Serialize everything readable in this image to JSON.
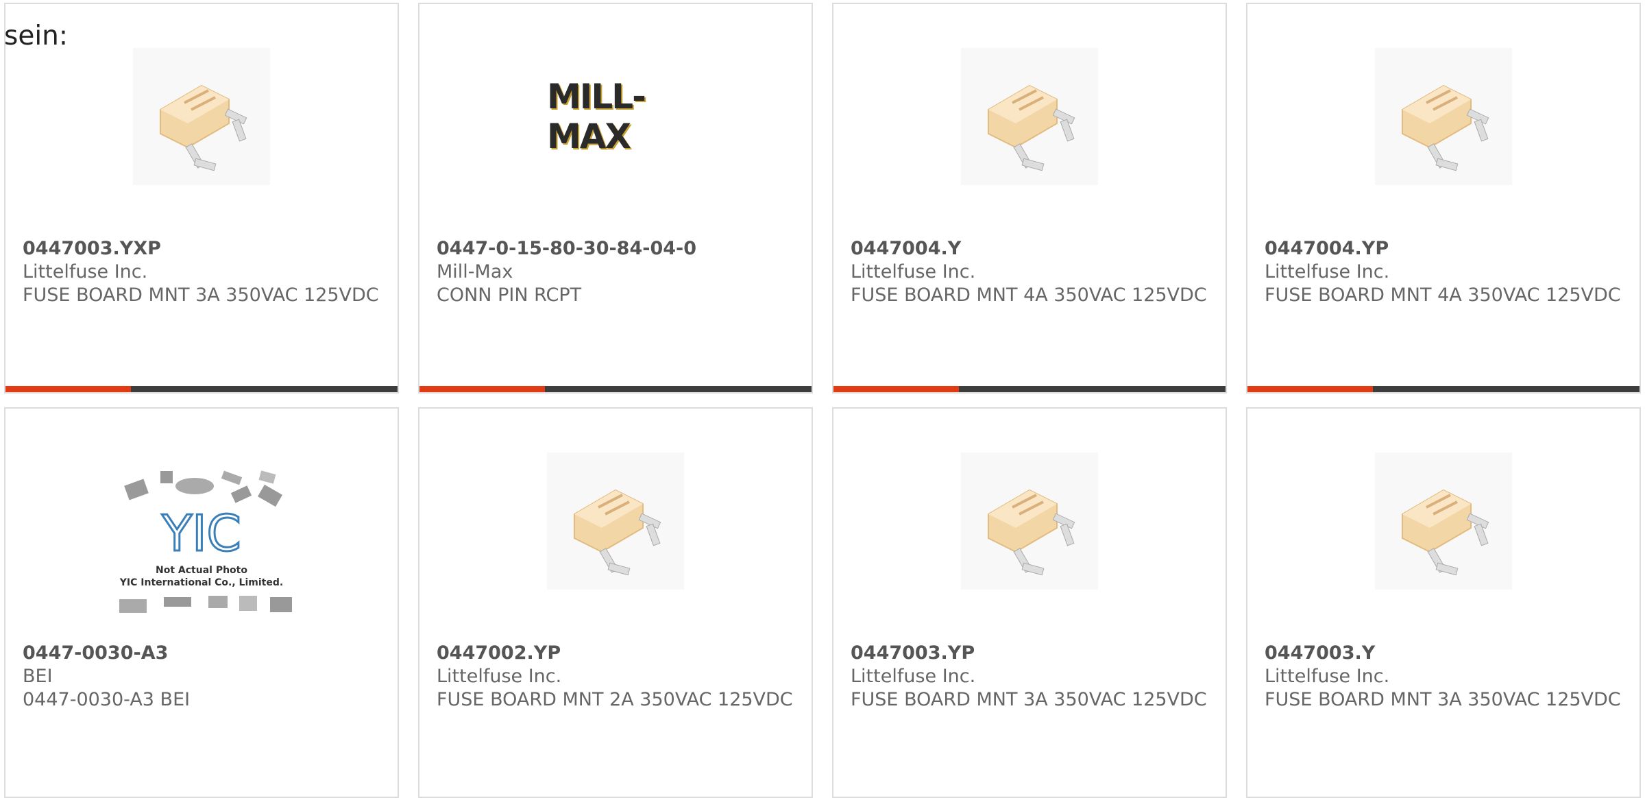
{
  "page": {
    "label": "sein:"
  },
  "products": [
    {
      "part": "0447003.YXP",
      "manufacturer": "Littelfuse Inc.",
      "description": "FUSE BOARD MNT 3A 350VAC 125VDC",
      "image": "fuse-icon",
      "has_bar": true
    },
    {
      "part": "0447-0-15-80-30-84-04-0",
      "manufacturer": "Mill-Max",
      "description": "CONN PIN RCPT",
      "image": "mill-max-logo",
      "logo_text": "MILL-MAX",
      "has_bar": true
    },
    {
      "part": "0447004.Y",
      "manufacturer": "Littelfuse Inc.",
      "description": "FUSE BOARD MNT 4A 350VAC 125VDC",
      "image": "fuse-icon",
      "has_bar": true
    },
    {
      "part": "0447004.YP",
      "manufacturer": "Littelfuse Inc.",
      "description": "FUSE BOARD MNT 4A 350VAC 125VDC",
      "image": "fuse-icon",
      "has_bar": true
    },
    {
      "part": "0447-0030-A3",
      "manufacturer": "BEI",
      "description": "0447-0030-A3 BEI",
      "image": "yic-placeholder",
      "placeholder_caption_1": "Not Actual Photo",
      "placeholder_caption_2": "YIC International Co., Limited.",
      "has_bar": false
    },
    {
      "part": "0447002.YP",
      "manufacturer": "Littelfuse Inc.",
      "description": "FUSE BOARD MNT 2A 350VAC 125VDC",
      "image": "fuse-icon",
      "has_bar": false
    },
    {
      "part": "0447003.YP",
      "manufacturer": "Littelfuse Inc.",
      "description": "FUSE BOARD MNT 3A 350VAC 125VDC",
      "image": "fuse-icon",
      "has_bar": false
    },
    {
      "part": "0447003.Y",
      "manufacturer": "Littelfuse Inc.",
      "description": "FUSE BOARD MNT 3A 350VAC 125VDC",
      "image": "fuse-icon",
      "has_bar": false
    }
  ],
  "colors": {
    "accent_bar": "#e03b12",
    "dark_bar": "#3d3d3d",
    "card_border": "#dcdcdc",
    "text": "#666666"
  }
}
